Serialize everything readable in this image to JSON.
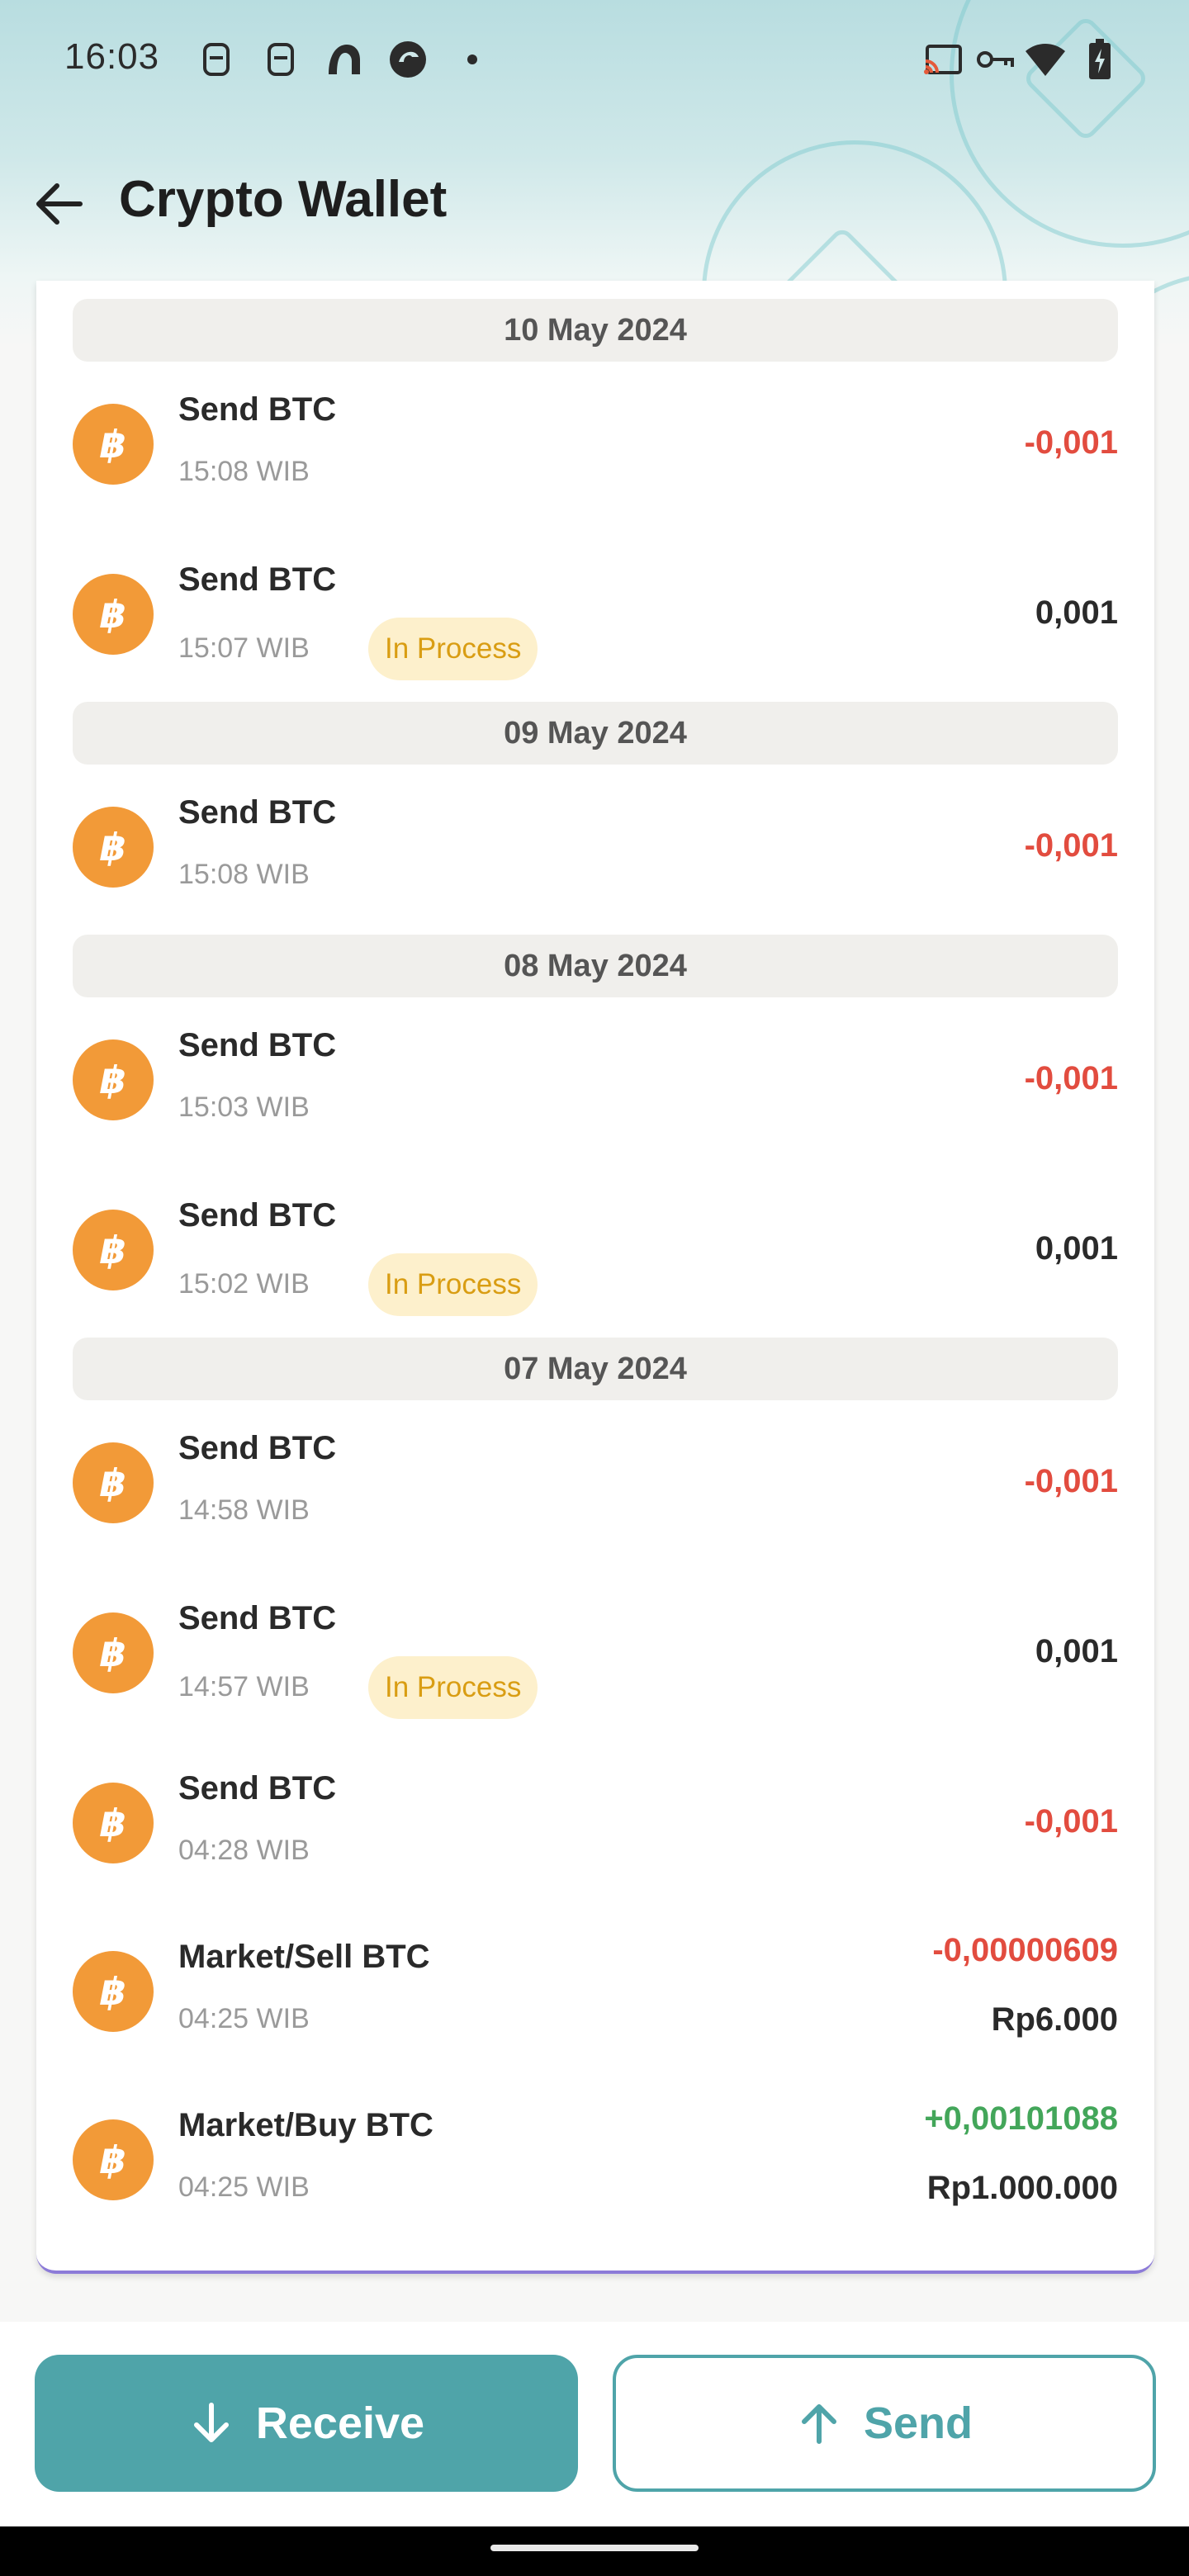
{
  "status_bar": {
    "time": "16:03",
    "left_icons": [
      "sim-icon",
      "sim-icon",
      "app-icon",
      "app-icon",
      "dot-icon"
    ],
    "right_icons": [
      "cast-icon",
      "vpn-key-icon",
      "wifi-icon",
      "battery-charging-icon"
    ]
  },
  "app_bar": {
    "back_icon": "arrow-left-icon",
    "title": "Crypto Wallet"
  },
  "colors": {
    "accent": "#4fa4a9",
    "negative": "#e24c3f",
    "positive": "#43a65a",
    "badge_bg": "#fdf0cc",
    "badge_text": "#d99d13",
    "coin": "#f29a38"
  },
  "groups": [
    {
      "date": "10 May 2024",
      "transactions": [
        {
          "title": "Send BTC",
          "time": "15:08 WIB",
          "amount": "-0,001",
          "type": "negative"
        },
        {
          "title": "Send BTC",
          "time": "15:07 WIB",
          "status": "In Process",
          "amount": "0,001",
          "type": "neutral"
        }
      ]
    },
    {
      "date": "09 May 2024",
      "transactions": [
        {
          "title": "Send BTC",
          "time": "15:08 WIB",
          "amount": "-0,001",
          "type": "negative"
        }
      ]
    },
    {
      "date": "08 May 2024",
      "transactions": [
        {
          "title": "Send BTC",
          "time": "15:03 WIB",
          "amount": "-0,001",
          "type": "negative"
        },
        {
          "title": "Send BTC",
          "time": "15:02 WIB",
          "status": "In Process",
          "amount": "0,001",
          "type": "neutral"
        }
      ]
    },
    {
      "date": "07 May 2024",
      "transactions": [
        {
          "title": "Send BTC",
          "time": "14:58 WIB",
          "amount": "-0,001",
          "type": "negative"
        },
        {
          "title": "Send BTC",
          "time": "14:57 WIB",
          "status": "In Process",
          "amount": "0,001",
          "type": "neutral"
        },
        {
          "title": "Send BTC",
          "time": "04:28 WIB",
          "amount": "-0,001",
          "type": "negative"
        },
        {
          "title": "Market/Sell BTC",
          "time": "04:25 WIB",
          "amount": "-0,00000609",
          "fiat": "Rp6.000",
          "type": "negative"
        },
        {
          "title": "Market/Buy BTC",
          "time": "04:25 WIB",
          "amount": "+0,00101088",
          "fiat": "Rp1.000.000",
          "type": "positive"
        }
      ]
    }
  ],
  "actions": {
    "receive_label": "Receive",
    "receive_icon": "arrow-down-icon",
    "send_label": "Send",
    "send_icon": "arrow-up-icon"
  }
}
